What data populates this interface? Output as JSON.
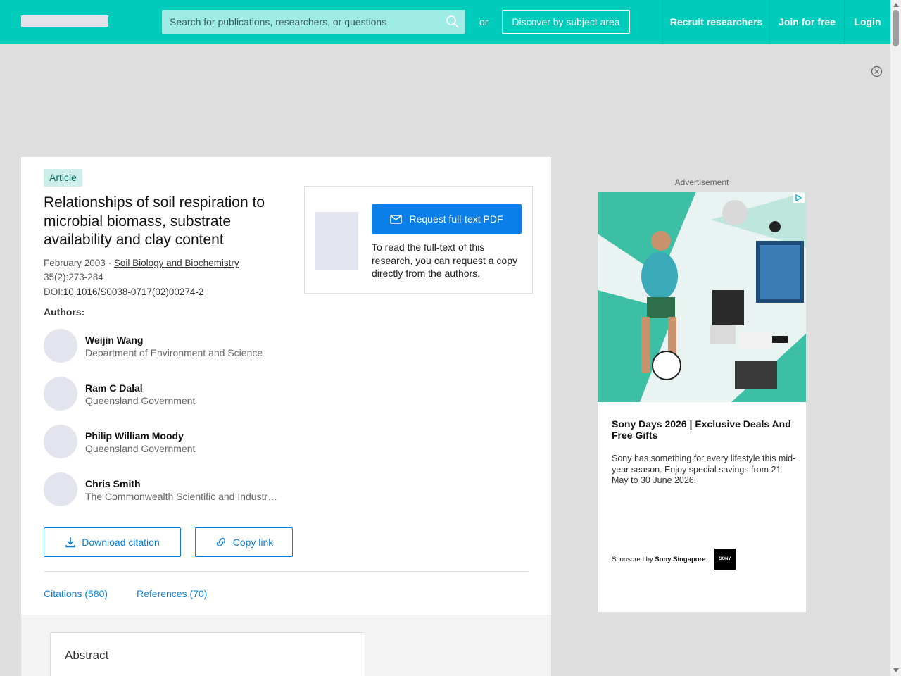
{
  "header": {
    "search_placeholder": "Search for publications, researchers, or questions",
    "or_text": "or",
    "discover_label": "Discover by subject area",
    "nav": {
      "recruit": "Recruit researchers",
      "join": "Join for free",
      "login": "Login"
    }
  },
  "article": {
    "type_badge": "Article",
    "title": "Relationships of soil respiration to microbial biomass, substrate availability and clay content",
    "date": "February 2003",
    "separator": " · ",
    "journal": "Soil Biology and Biochemistry",
    "issue_pages": "35(2):273-284",
    "doi_label": "DOI:",
    "doi": "10.1016/S0038-0717(02)00274-2",
    "authors_label": "Authors:",
    "authors": [
      {
        "name": "Weijin Wang",
        "affiliation": "Department of Environment and Science"
      },
      {
        "name": "Ram C Dalal",
        "affiliation": "Queensland Government"
      },
      {
        "name": "Philip William Moody",
        "affiliation": "Queensland Government"
      },
      {
        "name": "Chris Smith",
        "affiliation": "The Commonwealth Scientific and Industrial Research Organisation"
      }
    ],
    "download_citation_label": "Download citation",
    "copy_link_label": "Copy link",
    "tabs": {
      "citations": "Citations (580)",
      "references": "References (70)"
    },
    "abstract_title": "Abstract"
  },
  "request_panel": {
    "button_label": "Request full-text PDF",
    "description": "To read the full-text of this research, you can request a copy directly from the authors."
  },
  "advertisement": {
    "label": "Advertisement",
    "headline": "Sony Days 2026 | Exclusive Deals And Free Gifts",
    "body": "Sony has something for every lifestyle this mid-year season. Enjoy special savings from 21 May to 30 June 2026.",
    "sponsored_prefix": "Sponsored by",
    "sponsor": "Sony Singapore",
    "logo_text": "SONY"
  },
  "colors": {
    "brand": "#00ccbb",
    "link": "#0a7fd9",
    "primary_button": "#0a7fea"
  }
}
